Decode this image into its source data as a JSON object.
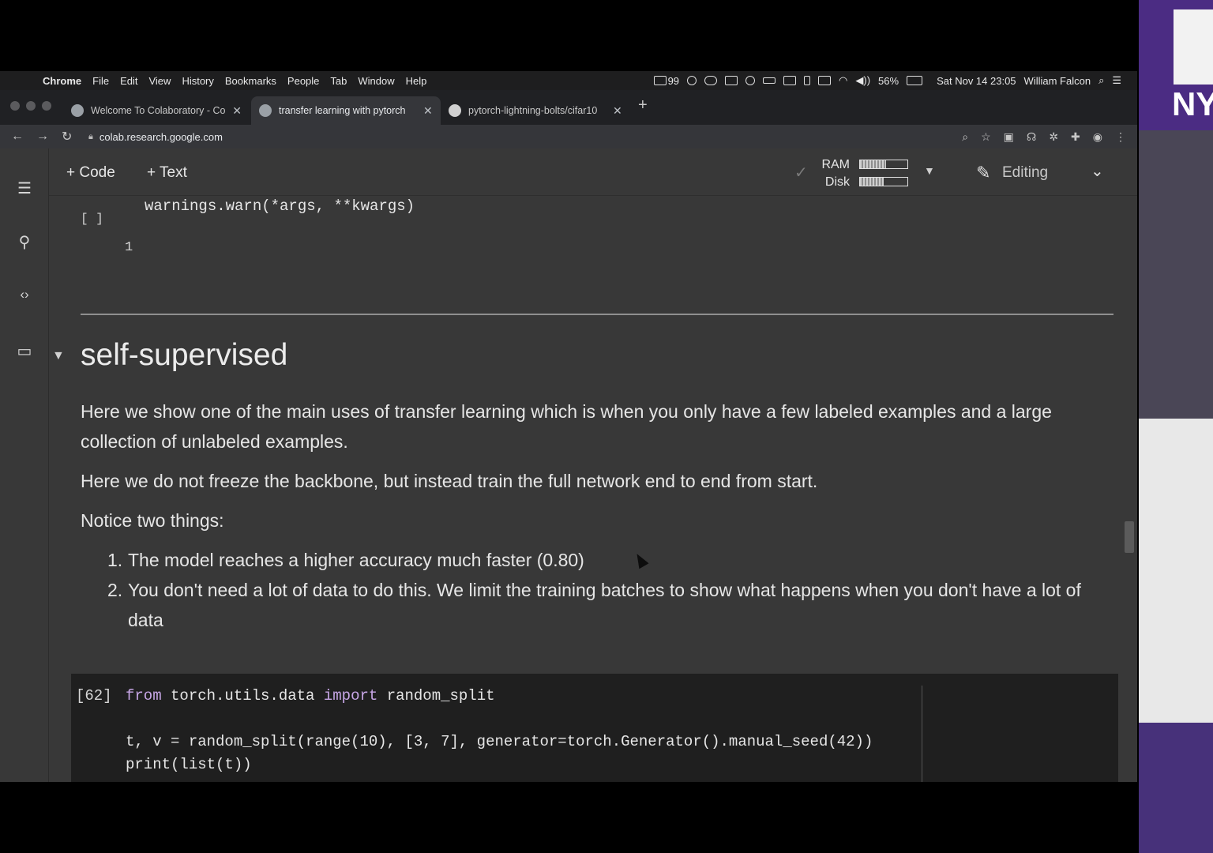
{
  "menubar": {
    "apple_glyph": "",
    "app": "Chrome",
    "items": [
      "File",
      "Edit",
      "View",
      "History",
      "Bookmarks",
      "People",
      "Tab",
      "Window",
      "Help"
    ],
    "mail_count": "99",
    "battery": "56%",
    "datetime": "Sat Nov 14  23:05",
    "user": "William Falcon"
  },
  "tabs": [
    {
      "title": "Welcome To Colaboratory - Co",
      "active": false
    },
    {
      "title": "transfer learning with pytorch",
      "active": true
    },
    {
      "title": "pytorch-lightning-bolts/cifar10",
      "active": false
    }
  ],
  "address": {
    "url": "colab.research.google.com"
  },
  "toolbar": {
    "add_code": "+ Code",
    "add_text": "+ Text",
    "ram_label": "RAM",
    "disk_label": "Disk",
    "ram_fraction": 0.55,
    "disk_fraction": 0.5,
    "editing_label": "Editing"
  },
  "notebook": {
    "output_line": "warnings.warn(*args, **kwargs)",
    "empty_cell_brackets": "[ ]",
    "line_number": "1",
    "section_heading": "self-supervised",
    "paragraphs": [
      "Here we show one of the main uses of transfer learning which is when you only have a few labeled examples and a large collection of unlabeled examples.",
      "Here we do not freeze the backbone, but instead train the full network end to end from start.",
      "Notice two things:"
    ],
    "list_items": [
      {
        "num": "1.",
        "text": "The model reaches a higher accuracy much faster (0.80)"
      },
      {
        "num": "2.",
        "text": "You don't need a lot of data to do this. We limit the training batches to show what happens when you don't have a lot of data"
      }
    ],
    "code_cell": {
      "exec_count": "[62]",
      "line1_kw_from": "from",
      "line1_module": "torch.utils.data",
      "line1_kw_import": "import",
      "line1_name": "random_split",
      "line2": "t, v = random_split(range(10), [3, 7], generator=torch.Generator().manual_seed(42))",
      "line3": "print(list(t))"
    }
  },
  "webcam": {
    "logo_text": "NY"
  },
  "colors": {
    "colab_bg": "#383838",
    "code_bg": "#1f1f1f",
    "nyu_purple": "#57068c"
  }
}
